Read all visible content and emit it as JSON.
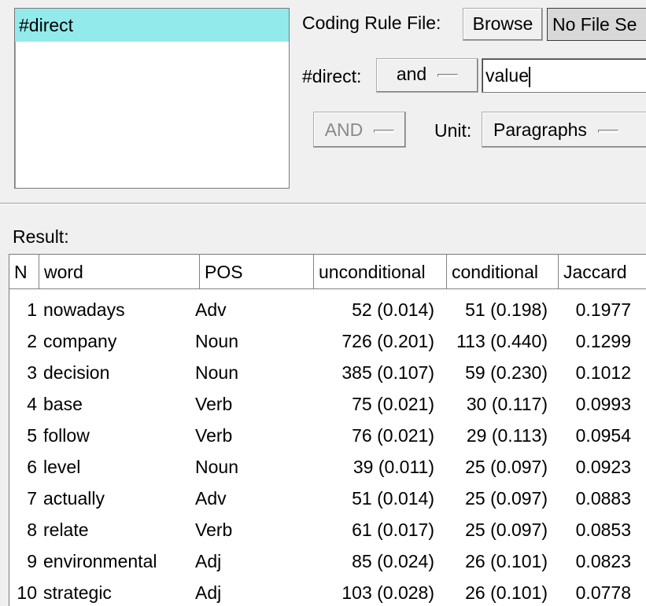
{
  "codes": {
    "selected": "#direct"
  },
  "rule_file": {
    "label": "Coding Rule File:",
    "browse": "Browse",
    "file": "No File Se"
  },
  "direct_row": {
    "label": "#direct:",
    "operator": "and",
    "value": "value"
  },
  "options": {
    "logic": "AND",
    "unit_label": "Unit:",
    "unit": "Paragraphs"
  },
  "result": {
    "label": "Result:",
    "columns": [
      "N",
      "word",
      "POS",
      "unconditional",
      "conditional",
      "Jaccard"
    ],
    "rows": [
      {
        "n": "1",
        "word": "nowadays",
        "pos": "Adv",
        "unconditional": "52 (0.014)",
        "conditional": "51 (0.198)",
        "jaccard": "0.1977"
      },
      {
        "n": "2",
        "word": "company",
        "pos": "Noun",
        "unconditional": "726 (0.201)",
        "conditional": "113 (0.440)",
        "jaccard": "0.1299"
      },
      {
        "n": "3",
        "word": "decision",
        "pos": "Noun",
        "unconditional": "385 (0.107)",
        "conditional": "59 (0.230)",
        "jaccard": "0.1012"
      },
      {
        "n": "4",
        "word": "base",
        "pos": "Verb",
        "unconditional": "75 (0.021)",
        "conditional": "30 (0.117)",
        "jaccard": "0.0993"
      },
      {
        "n": "5",
        "word": "follow",
        "pos": "Verb",
        "unconditional": "76 (0.021)",
        "conditional": "29 (0.113)",
        "jaccard": "0.0954"
      },
      {
        "n": "6",
        "word": "level",
        "pos": "Noun",
        "unconditional": "39 (0.011)",
        "conditional": "25 (0.097)",
        "jaccard": "0.0923"
      },
      {
        "n": "7",
        "word": "actually",
        "pos": "Adv",
        "unconditional": "51 (0.014)",
        "conditional": "25 (0.097)",
        "jaccard": "0.0883"
      },
      {
        "n": "8",
        "word": "relate",
        "pos": "Verb",
        "unconditional": "61 (0.017)",
        "conditional": "25 (0.097)",
        "jaccard": "0.0853"
      },
      {
        "n": "9",
        "word": "environmental",
        "pos": "Adj",
        "unconditional": "85 (0.024)",
        "conditional": "26 (0.101)",
        "jaccard": "0.0823"
      },
      {
        "n": "10",
        "word": "strategic",
        "pos": "Adj",
        "unconditional": "103 (0.028)",
        "conditional": "26 (0.101)",
        "jaccard": "0.0778"
      }
    ]
  }
}
